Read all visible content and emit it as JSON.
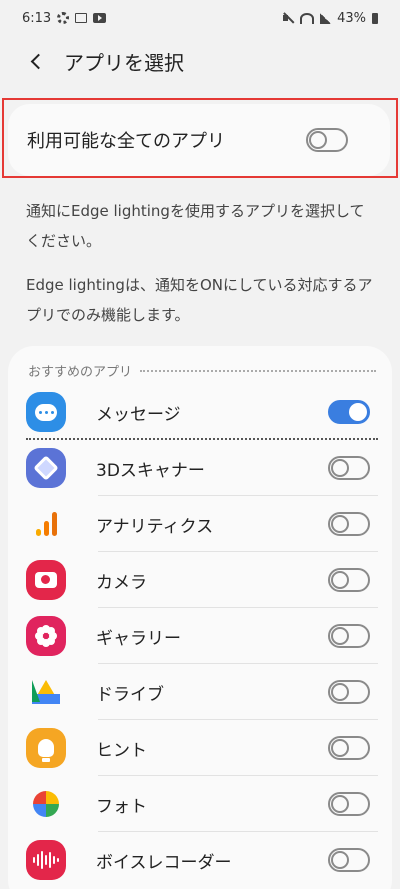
{
  "status_bar": {
    "time": "6:13",
    "battery": "43%"
  },
  "app_bar": {
    "title": "アプリを選択"
  },
  "all_apps": {
    "label": "利用可能な全てのアプリ",
    "enabled": false
  },
  "descriptions": [
    "通知にEdge lightingを使用するアプリを選択してください。",
    "Edge lightingは、通知をONにしている対応するアプリでのみ機能します。"
  ],
  "recommended": {
    "section_title": "おすすめのアプリ",
    "apps": [
      {
        "name": "メッセージ",
        "icon": "messages-icon",
        "enabled": true
      },
      {
        "name": "3Dスキャナー",
        "icon": "3d-scanner-icon",
        "enabled": false
      },
      {
        "name": "アナリティクス",
        "icon": "analytics-icon",
        "enabled": false
      },
      {
        "name": "カメラ",
        "icon": "camera-icon",
        "enabled": false
      },
      {
        "name": "ギャラリー",
        "icon": "gallery-icon",
        "enabled": false
      },
      {
        "name": "ドライブ",
        "icon": "drive-icon",
        "enabled": false
      },
      {
        "name": "ヒント",
        "icon": "tips-icon",
        "enabled": false
      },
      {
        "name": "フォト",
        "icon": "photos-icon",
        "enabled": false
      },
      {
        "name": "ボイスレコーダー",
        "icon": "voice-recorder-icon",
        "enabled": false
      }
    ]
  },
  "colors": {
    "accent": "#3a7ee0",
    "highlight": "#e53935"
  }
}
